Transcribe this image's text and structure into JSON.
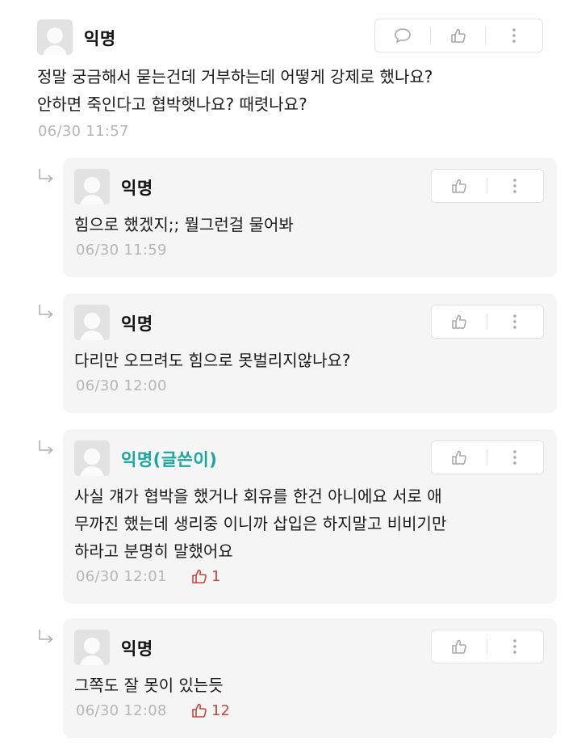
{
  "comment": {
    "author": "익명",
    "lines": [
      "정말 궁금해서 묻는건데 거부하는데 어떻게 강제로 했나요?",
      "안하면 죽인다고 협박햇나요? 때렷나요?"
    ],
    "time": "06/30 11:57"
  },
  "replies": [
    {
      "author": "익명",
      "lines": [
        "힘으로 했겠지;; 뭘그런걸 물어봐"
      ],
      "time": "06/30 11:59",
      "likes": ""
    },
    {
      "author": "익명",
      "lines": [
        "다리만 오므려도 힘으로 못벌리지않나요?"
      ],
      "time": "06/30 12:00",
      "likes": ""
    },
    {
      "author": "익명(글쓴이)",
      "lines": [
        "사실 걔가 협박을 했거나 회유를 한건 아니에요 서로 애",
        "무까진 했는데 생리중 이니까 삽입은 하지말고 비비기만",
        "하라고 분명히 말했어요"
      ],
      "time": "06/30 12:01",
      "likes": "1"
    },
    {
      "author": "익명",
      "lines": [
        "그쪽도 잘 못이 있는듯"
      ],
      "time": "06/30 12:08",
      "likes": "12"
    }
  ],
  "icons": {
    "comment": "speech-bubble-icon",
    "like": "thumbs-up-icon",
    "more": "vertical-ellipsis-icon",
    "reply": "reply-arrow-icon"
  },
  "colors": {
    "writer": "#1aa6a0",
    "like_count": "#c9463a",
    "timestamp": "#b6b6b6",
    "reply_bg": "#f5f5f5"
  }
}
